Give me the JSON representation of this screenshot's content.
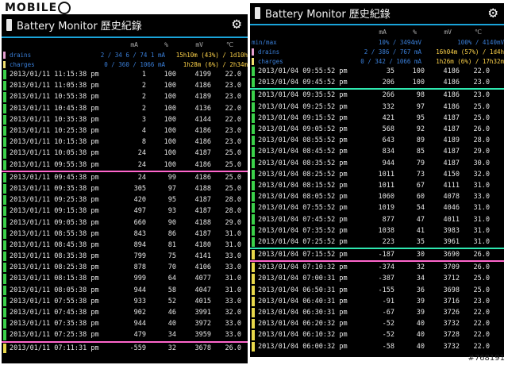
{
  "watermark": "MOBILE",
  "id_tag": "#768191",
  "colors": {
    "green": "#3bd14a",
    "yellow": "#e8d84a",
    "pink": "#ff66cc",
    "teal": "#2ee8b0",
    "blue": "#1aa3d9"
  },
  "left": {
    "title": "Battery Monitor 歷史紀錄",
    "columns": {
      "ma": "mA",
      "pct": "%",
      "mv": "mV",
      "temp": "℃"
    },
    "drains": {
      "label": "drains",
      "mid": "2 / 34 6 / 74 1 mA",
      "right": "15h10m (43%) / 1d10h"
    },
    "charges": {
      "label": "charges",
      "mid": "0 / 360 / 1066 mA",
      "right": "1h28m (6%) / 2h34m"
    },
    "rows": [
      {
        "ts": "2013/01/11 11:15:38 pm",
        "ma": "1",
        "pct": "100",
        "mv": "4199",
        "t": "22.0",
        "bar": "green"
      },
      {
        "ts": "2013/01/11 11:05:38 pm",
        "ma": "2",
        "pct": "100",
        "mv": "4186",
        "t": "23.0",
        "bar": "green"
      },
      {
        "ts": "2013/01/11 10:55:38 pm",
        "ma": "2",
        "pct": "100",
        "mv": "4189",
        "t": "23.0",
        "bar": "green"
      },
      {
        "ts": "2013/01/11 10:45:38 pm",
        "ma": "2",
        "pct": "100",
        "mv": "4136",
        "t": "22.0",
        "bar": "green"
      },
      {
        "ts": "2013/01/11 10:35:38 pm",
        "ma": "3",
        "pct": "100",
        "mv": "4144",
        "t": "22.0",
        "bar": "green"
      },
      {
        "ts": "2013/01/11 10:25:38 pm",
        "ma": "4",
        "pct": "100",
        "mv": "4186",
        "t": "23.0",
        "bar": "green"
      },
      {
        "ts": "2013/01/11 10:15:38 pm",
        "ma": "8",
        "pct": "100",
        "mv": "4186",
        "t": "23.0",
        "bar": "green"
      },
      {
        "ts": "2013/01/11 10:05:38 pm",
        "ma": "24",
        "pct": "100",
        "mv": "4187",
        "t": "25.0",
        "bar": "green"
      },
      {
        "ts": "2013/01/11 09:55:38 pm",
        "ma": "24",
        "pct": "100",
        "mv": "4186",
        "t": "25.0",
        "bar": "green",
        "line": "pink"
      },
      {
        "ts": "2013/01/11 09:45:38 pm",
        "ma": "24",
        "pct": "99",
        "mv": "4186",
        "t": "25.0",
        "bar": "green"
      },
      {
        "ts": "2013/01/11 09:35:38 pm",
        "ma": "305",
        "pct": "97",
        "mv": "4188",
        "t": "25.0",
        "bar": "green"
      },
      {
        "ts": "2013/01/11 09:25:38 pm",
        "ma": "420",
        "pct": "95",
        "mv": "4187",
        "t": "28.0",
        "bar": "green"
      },
      {
        "ts": "2013/01/11 09:15:38 pm",
        "ma": "497",
        "pct": "93",
        "mv": "4187",
        "t": "28.0",
        "bar": "green"
      },
      {
        "ts": "2013/01/11 09:05:38 pm",
        "ma": "660",
        "pct": "90",
        "mv": "4188",
        "t": "29.0",
        "bar": "green"
      },
      {
        "ts": "2013/01/11 08:55:38 pm",
        "ma": "843",
        "pct": "86",
        "mv": "4187",
        "t": "31.0",
        "bar": "green"
      },
      {
        "ts": "2013/01/11 08:45:38 pm",
        "ma": "894",
        "pct": "81",
        "mv": "4180",
        "t": "31.0",
        "bar": "green"
      },
      {
        "ts": "2013/01/11 08:35:38 pm",
        "ma": "799",
        "pct": "75",
        "mv": "4141",
        "t": "33.0",
        "bar": "green"
      },
      {
        "ts": "2013/01/11 08:25:38 pm",
        "ma": "878",
        "pct": "70",
        "mv": "4106",
        "t": "33.0",
        "bar": "green"
      },
      {
        "ts": "2013/01/11 08:15:38 pm",
        "ma": "999",
        "pct": "64",
        "mv": "4077",
        "t": "31.0",
        "bar": "green"
      },
      {
        "ts": "2013/01/11 08:05:38 pm",
        "ma": "944",
        "pct": "58",
        "mv": "4047",
        "t": "31.0",
        "bar": "green"
      },
      {
        "ts": "2013/01/11 07:55:38 pm",
        "ma": "933",
        "pct": "52",
        "mv": "4015",
        "t": "33.0",
        "bar": "green"
      },
      {
        "ts": "2013/01/11 07:45:38 pm",
        "ma": "902",
        "pct": "46",
        "mv": "3991",
        "t": "32.0",
        "bar": "green"
      },
      {
        "ts": "2013/01/11 07:35:38 pm",
        "ma": "944",
        "pct": "40",
        "mv": "3972",
        "t": "33.0",
        "bar": "green"
      },
      {
        "ts": "2013/01/11 07:25:38 pm",
        "ma": "479",
        "pct": "34",
        "mv": "3959",
        "t": "33.0",
        "bar": "green",
        "line": "pink"
      },
      {
        "ts": "2013/01/11 07:11:31 pm",
        "ma": "-559",
        "pct": "32",
        "mv": "3678",
        "t": "26.0",
        "bar": "yellow"
      }
    ]
  },
  "right": {
    "title": "Battery Monitor 歷史紀錄",
    "columns": {
      "ma": "mA",
      "pct": "%",
      "mv": "mV",
      "temp": "℃"
    },
    "minmax": {
      "label": "min/max",
      "mid": "10% / 3494mV",
      "right": "100% / 4140mV"
    },
    "drains": {
      "label": "drains",
      "mid": "2 / 386 / 767 mA",
      "right": "16h04m (57%) / 1d4h"
    },
    "charges": {
      "label": "charges",
      "mid": "0 / 342 / 1066 mA",
      "right": "1h26m (6%) / 17h32m"
    },
    "rows": [
      {
        "ts": "2013/01/04 09:55:52 pm",
        "ma": "35",
        "pct": "100",
        "mv": "4186",
        "t": "22.0",
        "bar": "green"
      },
      {
        "ts": "2013/01/04 09:45:52 pm",
        "ma": "206",
        "pct": "100",
        "mv": "4186",
        "t": "23.0",
        "bar": "green",
        "line": "teal"
      },
      {
        "ts": "2013/01/04 09:35:52 pm",
        "ma": "266",
        "pct": "98",
        "mv": "4186",
        "t": "23.0",
        "bar": "green"
      },
      {
        "ts": "2013/01/04 09:25:52 pm",
        "ma": "332",
        "pct": "97",
        "mv": "4186",
        "t": "25.0",
        "bar": "green"
      },
      {
        "ts": "2013/01/04 09:15:52 pm",
        "ma": "421",
        "pct": "95",
        "mv": "4187",
        "t": "25.0",
        "bar": "green"
      },
      {
        "ts": "2013/01/04 09:05:52 pm",
        "ma": "568",
        "pct": "92",
        "mv": "4187",
        "t": "26.0",
        "bar": "green"
      },
      {
        "ts": "2013/01/04 08:55:52 pm",
        "ma": "643",
        "pct": "89",
        "mv": "4189",
        "t": "28.0",
        "bar": "green"
      },
      {
        "ts": "2013/01/04 08:45:52 pm",
        "ma": "834",
        "pct": "85",
        "mv": "4187",
        "t": "29.0",
        "bar": "green"
      },
      {
        "ts": "2013/01/04 08:35:52 pm",
        "ma": "944",
        "pct": "79",
        "mv": "4187",
        "t": "30.0",
        "bar": "green"
      },
      {
        "ts": "2013/01/04 08:25:52 pm",
        "ma": "1011",
        "pct": "73",
        "mv": "4150",
        "t": "32.0",
        "bar": "green"
      },
      {
        "ts": "2013/01/04 08:15:52 pm",
        "ma": "1011",
        "pct": "67",
        "mv": "4111",
        "t": "31.0",
        "bar": "green"
      },
      {
        "ts": "2013/01/04 08:05:52 pm",
        "ma": "1060",
        "pct": "60",
        "mv": "4078",
        "t": "33.0",
        "bar": "green"
      },
      {
        "ts": "2013/01/04 07:55:52 pm",
        "ma": "1019",
        "pct": "54",
        "mv": "4046",
        "t": "31.0",
        "bar": "green"
      },
      {
        "ts": "2013/01/04 07:45:52 pm",
        "ma": "877",
        "pct": "47",
        "mv": "4011",
        "t": "31.0",
        "bar": "green"
      },
      {
        "ts": "2013/01/04 07:35:52 pm",
        "ma": "1038",
        "pct": "41",
        "mv": "3983",
        "t": "31.0",
        "bar": "green"
      },
      {
        "ts": "2013/01/04 07:25:52 pm",
        "ma": "223",
        "pct": "35",
        "mv": "3961",
        "t": "31.0",
        "bar": "green",
        "line": "teal"
      },
      {
        "ts": "2013/01/04 07:15:52 pm",
        "ma": "-187",
        "pct": "30",
        "mv": "3690",
        "t": "26.0",
        "bar": "yellow",
        "line": "pink"
      },
      {
        "ts": "2013/01/04 07:10:32 pm",
        "ma": "-374",
        "pct": "32",
        "mv": "3709",
        "t": "26.0",
        "bar": "yellow"
      },
      {
        "ts": "2013/01/04 07:00:31 pm",
        "ma": "-387",
        "pct": "34",
        "mv": "3712",
        "t": "25.0",
        "bar": "yellow"
      },
      {
        "ts": "2013/01/04 06:50:31 pm",
        "ma": "-155",
        "pct": "36",
        "mv": "3698",
        "t": "25.0",
        "bar": "yellow"
      },
      {
        "ts": "2013/01/04 06:40:31 pm",
        "ma": "-91",
        "pct": "39",
        "mv": "3716",
        "t": "23.0",
        "bar": "yellow"
      },
      {
        "ts": "2013/01/04 06:30:31 pm",
        "ma": "-67",
        "pct": "39",
        "mv": "3726",
        "t": "22.0",
        "bar": "yellow"
      },
      {
        "ts": "2013/01/04 06:20:32 pm",
        "ma": "-52",
        "pct": "40",
        "mv": "3732",
        "t": "22.0",
        "bar": "yellow"
      },
      {
        "ts": "2013/01/04 06:10:32 pm",
        "ma": "-52",
        "pct": "40",
        "mv": "3728",
        "t": "22.0",
        "bar": "yellow"
      },
      {
        "ts": "2013/01/04 06:00:32 pm",
        "ma": "-58",
        "pct": "40",
        "mv": "3732",
        "t": "22.0",
        "bar": "yellow"
      }
    ]
  }
}
